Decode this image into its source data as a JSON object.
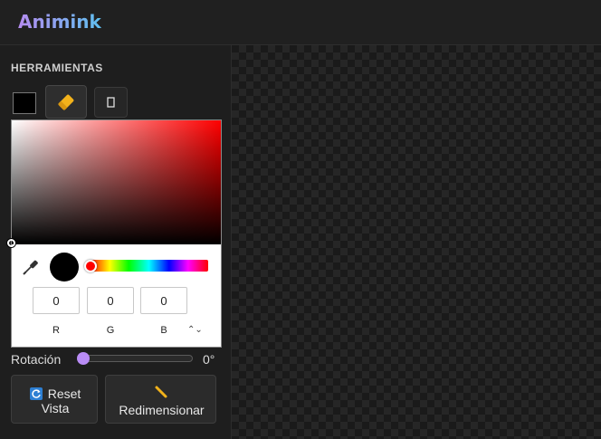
{
  "app": {
    "title": "Animink"
  },
  "tools": {
    "section_title": "HERRAMIENTAS",
    "current_color": "#000000",
    "eraser_icon": "eraser-icon",
    "frame_icon": "frame-icon"
  },
  "color_picker": {
    "hue_color": "#ff0000",
    "selected_color": "#000000",
    "eyedropper_icon": "eyedropper-icon",
    "r": "0",
    "g": "0",
    "b": "0",
    "labels": {
      "r": "R",
      "g": "G",
      "b": "B"
    },
    "mode_toggle": "⌃⌄"
  },
  "rotation": {
    "label": "Rotación",
    "value": 0,
    "value_text": "0°"
  },
  "actions": {
    "reset_line1": "Reset",
    "reset_line2": "Vista",
    "reset_icon": "refresh-icon",
    "resize_label": "Redimensionar",
    "resize_icon": "ruler-icon"
  }
}
